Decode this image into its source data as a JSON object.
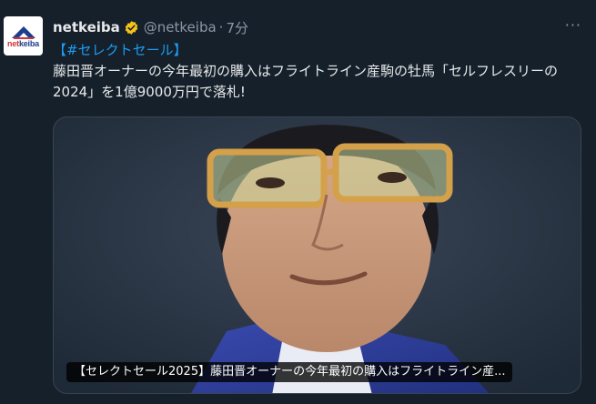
{
  "account": {
    "name": "netkeiba",
    "handle": "@netkeiba",
    "separator": "·",
    "time": "7分",
    "avatar_logo_text_prefix": "net",
    "avatar_logo_text_suffix": "keiba",
    "verified": true,
    "verified_color": "#f4c21b"
  },
  "menu": {
    "more_label": "···"
  },
  "tweet": {
    "hashtag_line": "【#セレクトセール】",
    "body": "藤田晋オーナーの今年最初の購入はフライトライン産駒の牡馬「セルフレスリーの2024」を1億9000万円で落札!"
  },
  "media": {
    "type": "link-card-image",
    "caption": "【セレクトセール2025】藤田晋オーナーの今年最初の購入はフライトライン産..."
  },
  "colors": {
    "background": "#15202b",
    "text": "#e7e9ea",
    "secondary": "#8b98a5",
    "link": "#1d9bf0"
  }
}
